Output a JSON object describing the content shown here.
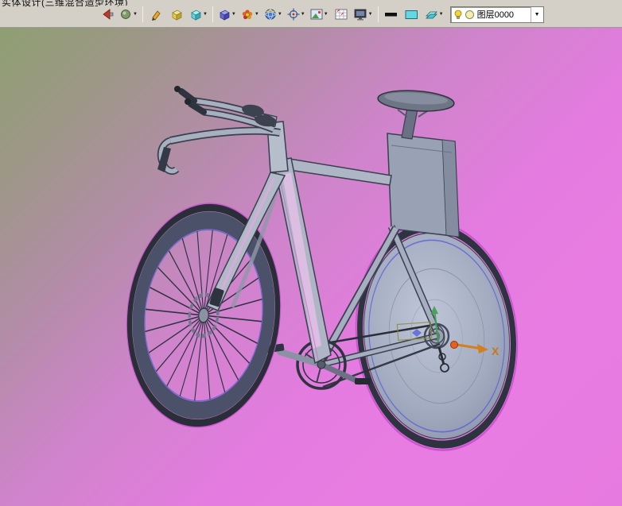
{
  "title_bar": {
    "text": "实体设计(三维混合造型环境)"
  },
  "toolbar": {
    "buttons": [
      {
        "name": "exit-render-button",
        "icon": "red-arrow-icon",
        "dropdown": false
      },
      {
        "name": "render-mode-button",
        "icon": "render-sphere-icon",
        "dropdown": true
      },
      {
        "name": "sketch-button",
        "icon": "pencil-icon",
        "dropdown": false
      },
      {
        "name": "yellow-box-button",
        "icon": "yellow-box-icon",
        "dropdown": false
      },
      {
        "name": "cyan-box-button",
        "icon": "cyan-box-icon",
        "dropdown": true
      },
      {
        "name": "material-button",
        "icon": "material-cube-icon",
        "dropdown": true
      },
      {
        "name": "color-wheel-button",
        "icon": "color-wheel-icon",
        "dropdown": true
      },
      {
        "name": "environment-button",
        "icon": "globe-icon",
        "dropdown": true
      },
      {
        "name": "target-button",
        "icon": "crosshair-icon",
        "dropdown": true
      },
      {
        "name": "image-button",
        "icon": "image-icon",
        "dropdown": true
      },
      {
        "name": "texture-grid-button",
        "icon": "texture-grid-icon",
        "dropdown": false
      },
      {
        "name": "display-button",
        "icon": "monitor-icon",
        "dropdown": true
      },
      {
        "name": "line-width-button",
        "icon": "thick-line-icon",
        "dropdown": false
      },
      {
        "name": "fill-color-button",
        "icon": "cyan-swatch-icon",
        "dropdown": false
      },
      {
        "name": "layer-style-button",
        "icon": "layer-sheet-icon",
        "dropdown": true
      }
    ],
    "layer_combo": {
      "value": "图层0000",
      "icons": [
        "lightbulb-icon",
        "layer-circle-icon"
      ]
    }
  },
  "viewport": {
    "axis": {
      "x_label": "X"
    },
    "background": {
      "top_left": "#8f9f72",
      "bottom_right": "#e97ce2"
    },
    "model": "time-trial-bicycle"
  }
}
